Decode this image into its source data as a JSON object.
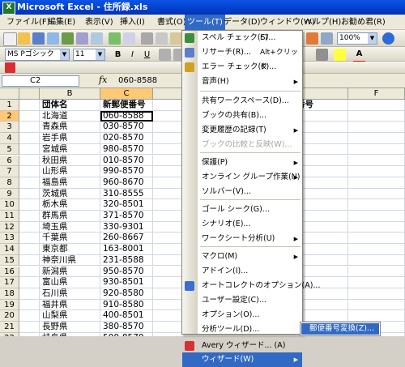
{
  "window": {
    "title": "Microsoft Excel - 住所録.xls"
  },
  "menubar": {
    "items": [
      {
        "label": "ファイル(F)",
        "name": "menu-file"
      },
      {
        "label": "編集(E)",
        "name": "menu-edit"
      },
      {
        "label": "表示(V)",
        "name": "menu-view"
      },
      {
        "label": "挿入(I)",
        "name": "menu-insert"
      },
      {
        "label": "書式(O)",
        "name": "menu-format"
      },
      {
        "label": "ツール(T)",
        "name": "menu-tools"
      },
      {
        "label": "データ(D)",
        "name": "menu-data"
      },
      {
        "label": "ウィンドウ(W)",
        "name": "menu-window"
      },
      {
        "label": "ヘルプ(H)",
        "name": "menu-help"
      },
      {
        "label": "お勧め君(R)",
        "name": "menu-osusume"
      }
    ]
  },
  "toolbar": {
    "zoom": "100%",
    "font": "MS Pゴシック",
    "size": "11",
    "bold": "B",
    "italic": "I",
    "underline": "U"
  },
  "formula": {
    "cell_ref": "C2",
    "fx": "fx",
    "value": "060-8588"
  },
  "sheet": {
    "columns": [
      "B",
      "C",
      "D",
      "E",
      "F"
    ],
    "rows": [
      "1",
      "2",
      "3",
      "4",
      "5",
      "6",
      "7",
      "8",
      "9",
      "10",
      "11",
      "12",
      "13",
      "14",
      "15",
      "16",
      "17",
      "18",
      "19",
      "20",
      "21",
      "22",
      "23"
    ],
    "col_b": [
      "団体名",
      "北海道",
      "青森県",
      "岩手県",
      "宮城県",
      "秋田県",
      "山形県",
      "福島県",
      "茨城県",
      "栃木県",
      "群馬県",
      "埼玉県",
      "千葉県",
      "東京都",
      "神奈川県",
      "新潟県",
      "富山県",
      "石川県",
      "福井県",
      "山梨県",
      "長野県",
      "岐阜県",
      "静岡県"
    ],
    "col_c": [
      "新郵便番号",
      "060-8588",
      "030-8570",
      "020-8570",
      "980-8570",
      "010-8570",
      "990-8570",
      "960-8670",
      "310-8555",
      "320-8501",
      "371-8570",
      "330-9301",
      "260-8667",
      "163-8001",
      "231-8588",
      "950-8570",
      "930-8501",
      "920-8580",
      "910-8580",
      "400-8501",
      "380-8570",
      "500-8570",
      "420-8601"
    ],
    "col_e_header": "電話番号"
  },
  "tools_menu": {
    "items": [
      {
        "label": "スペル チェック(S)...",
        "shortcut": "F7",
        "name": "menu-item-spelling",
        "icon": "spelling-icon"
      },
      {
        "label": "リサーチ(R)...",
        "shortcut": "Alt+クリック",
        "name": "menu-item-research",
        "icon": "research-icon"
      },
      {
        "label": "エラー チェック(K)...",
        "name": "menu-item-error-check",
        "icon": "error-check-icon"
      },
      {
        "label": "音声(H)",
        "name": "menu-item-speech",
        "submenu": true
      },
      {
        "label": "共有ワークスペース(D)...",
        "name": "menu-item-shared-workspace"
      },
      {
        "label": "ブックの共有(B)...",
        "name": "menu-item-share-book"
      },
      {
        "label": "変更履歴の記録(T)",
        "name": "menu-item-track-changes",
        "submenu": true
      },
      {
        "label": "ブックの比較と反映(W)...",
        "name": "menu-item-compare-merge",
        "disabled": true
      },
      {
        "label": "保護(P)",
        "name": "menu-item-protection",
        "submenu": true
      },
      {
        "label": "オンライン グループ作業(N)",
        "name": "menu-item-online-collab",
        "submenu": true
      },
      {
        "label": "ソルバー(V)...",
        "name": "menu-item-solver"
      },
      {
        "label": "ゴール シーク(G)...",
        "name": "menu-item-goal-seek"
      },
      {
        "label": "シナリオ(E)...",
        "name": "menu-item-scenario"
      },
      {
        "label": "ワークシート分析(U)",
        "name": "menu-item-formula-auditing",
        "submenu": true
      },
      {
        "label": "マクロ(M)",
        "name": "menu-item-macro",
        "submenu": true
      },
      {
        "label": "アドイン(I)...",
        "name": "menu-item-addins"
      },
      {
        "label": "オートコレクトのオプション(A)...",
        "name": "menu-item-autocorrect",
        "icon": "autocorrect-icon"
      },
      {
        "label": "ユーザー設定(C)...",
        "name": "menu-item-customize"
      },
      {
        "label": "オプション(O)...",
        "name": "menu-item-options"
      },
      {
        "label": "分析ツール(D)...",
        "name": "menu-item-data-analysis"
      },
      {
        "label": "Avery ウィザード... (A)",
        "name": "menu-item-avery-wizard",
        "icon": "avery-icon"
      },
      {
        "label": "ウィザード(W)",
        "name": "menu-item-wizard",
        "submenu": true,
        "highlighted": true
      }
    ]
  },
  "wizard_submenu": {
    "items": [
      {
        "label": "郵便番号変換(Z)...",
        "name": "submenu-item-postal-convert"
      }
    ]
  },
  "colors": {
    "title_bar": "#0a54e6",
    "menu_highlight": "#316ac5",
    "selected_header": "#ffc875"
  }
}
